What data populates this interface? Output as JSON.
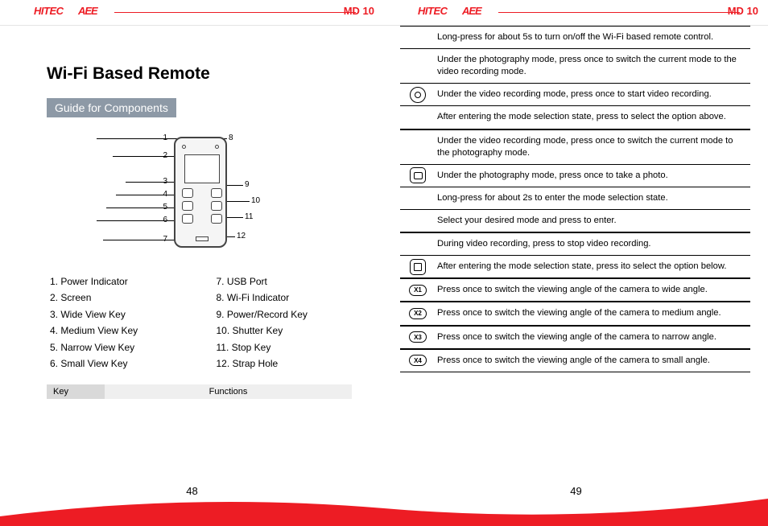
{
  "brand": "HITEC",
  "brand2": "AEE",
  "model": "MD 10",
  "leftPage": {
    "title": "Wi-Fi Based Remote",
    "subhead": "Guide for Components",
    "labels": [
      "1",
      "2",
      "3",
      "4",
      "5",
      "6",
      "7",
      "8",
      "9",
      "10",
      "11",
      "12"
    ],
    "componentsCol1": [
      "1. Power Indicator",
      "2. Screen",
      "3. Wide View Key",
      "4. Medium View Key",
      "5. Narrow View Key",
      "6. Small View Key"
    ],
    "componentsCol2": [
      "7. USB Port",
      "8. Wi-Fi Indicator",
      "9. Power/Record Key",
      "10. Shutter Key",
      "11. Stop Key",
      "12. Strap Hole"
    ],
    "tableHead": {
      "key": "Key",
      "fn": "Functions"
    },
    "pageNum": "48"
  },
  "rightPage": {
    "rows": {
      "g1r1": "Long-press for about 5s to turn on/off the Wi-Fi based remote control.",
      "g1r2": "Under the photography mode, press once to switch the current mode to the video recording mode.",
      "g1r3": "Under the video recording mode, press once to start video recording.",
      "g1r4": "After entering the mode selection state, press to select the option above.",
      "g2r1": "Under the video recording mode, press once to switch the current mode to the photography mode.",
      "g2r2": "Under the photography mode, press once to take a photo.",
      "g2r3": "Long-press for about 2s to enter the mode selection state.",
      "g2r4": "Select your desired mode and press to enter.",
      "g3r1": "During video recording, press to stop video recording.",
      "g3r2": "After entering the mode selection state, press ito select the option below.",
      "x1": "Press once to switch the viewing angle of the camera to wide angle.",
      "x2": "Press once to switch the viewing angle of the camera to medium angle.",
      "x3": "Press once to switch the viewing angle of the camera to narrow angle.",
      "x4": "Press once to switch the viewing angle of the camera to small angle."
    },
    "xlabels": {
      "x1": "X1",
      "x2": "X2",
      "x3": "X3",
      "x4": "X4"
    },
    "pageNum": "49"
  }
}
